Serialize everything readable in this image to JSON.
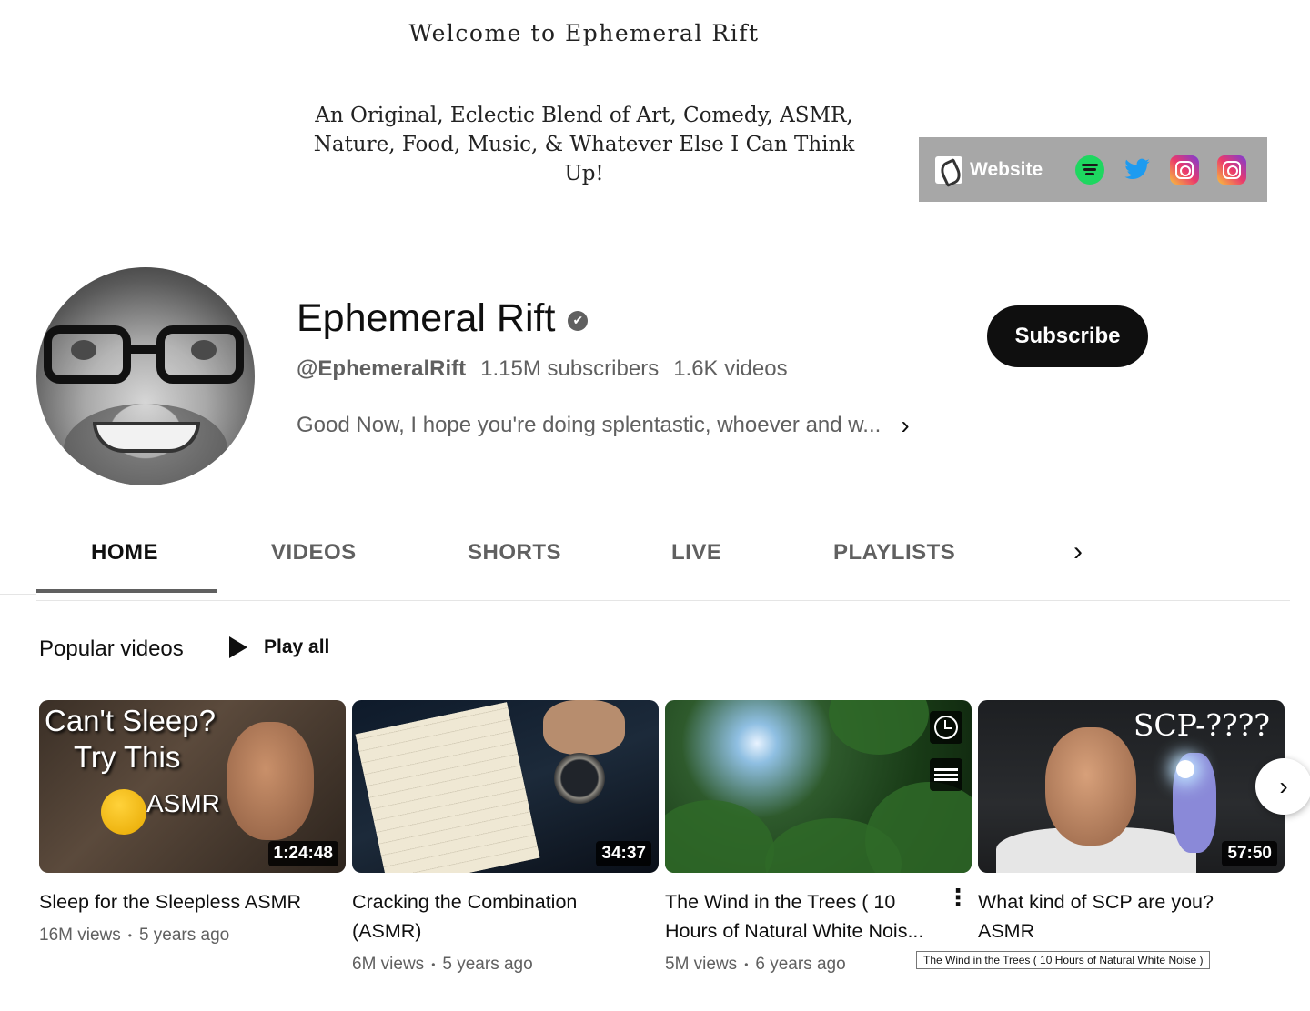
{
  "banner": {
    "title": "Welcome to Ephemeral Rift",
    "subtitle_line1": "An Original, Eclectic Blend of Art, Comedy, ASMR,",
    "subtitle_line2": "Nature, Food, Music, & Whatever Else I Can Think Up!",
    "links": {
      "website_label": "Website",
      "icons": [
        "website-icon",
        "spotify-icon",
        "twitter-icon",
        "instagram-icon",
        "instagram-icon"
      ],
      "box_color": "#a7a7a7"
    }
  },
  "channel": {
    "name": "Ephemeral Rift",
    "verified_icon": "✔",
    "handle": "@EphemeralRift",
    "subscribers": "1.15M subscribers",
    "video_count": "1.6K videos",
    "description": "Good Now, I hope you're doing splentastic, whoever and w...",
    "subscribe_label": "Subscribe"
  },
  "tabs": [
    {
      "label": "HOME",
      "active": true
    },
    {
      "label": "VIDEOS",
      "active": false
    },
    {
      "label": "SHORTS",
      "active": false
    },
    {
      "label": "LIVE",
      "active": false
    },
    {
      "label": "PLAYLISTS",
      "active": false
    }
  ],
  "section": {
    "title": "Popular videos",
    "play_all_label": "Play all"
  },
  "videos": [
    {
      "title": "Sleep for the Sleepless ASMR",
      "duration": "1:24:48",
      "views": "16M views",
      "age": "5 years ago",
      "thumb_text": [
        "Can't Sleep?",
        "Try This",
        "ASMR"
      ]
    },
    {
      "title": "Cracking the Combination (ASMR)",
      "duration": "34:37",
      "views": "6M views",
      "age": "5 years ago"
    },
    {
      "title": "The Wind in the Trees ( 10 Hours of Natural White Nois...",
      "duration": "",
      "views": "5M views",
      "age": "6 years ago"
    },
    {
      "title": "What kind of SCP are you? ASMR",
      "duration": "57:50",
      "thumb_text": [
        "SCP-????"
      ]
    }
  ],
  "tooltip": "The Wind in the Trees ( 10 Hours of Natural White Noise )",
  "colors": {
    "primary_text": "#0f0f0f",
    "secondary_text": "#606060",
    "subscribe_bg": "#0f0f0f"
  }
}
